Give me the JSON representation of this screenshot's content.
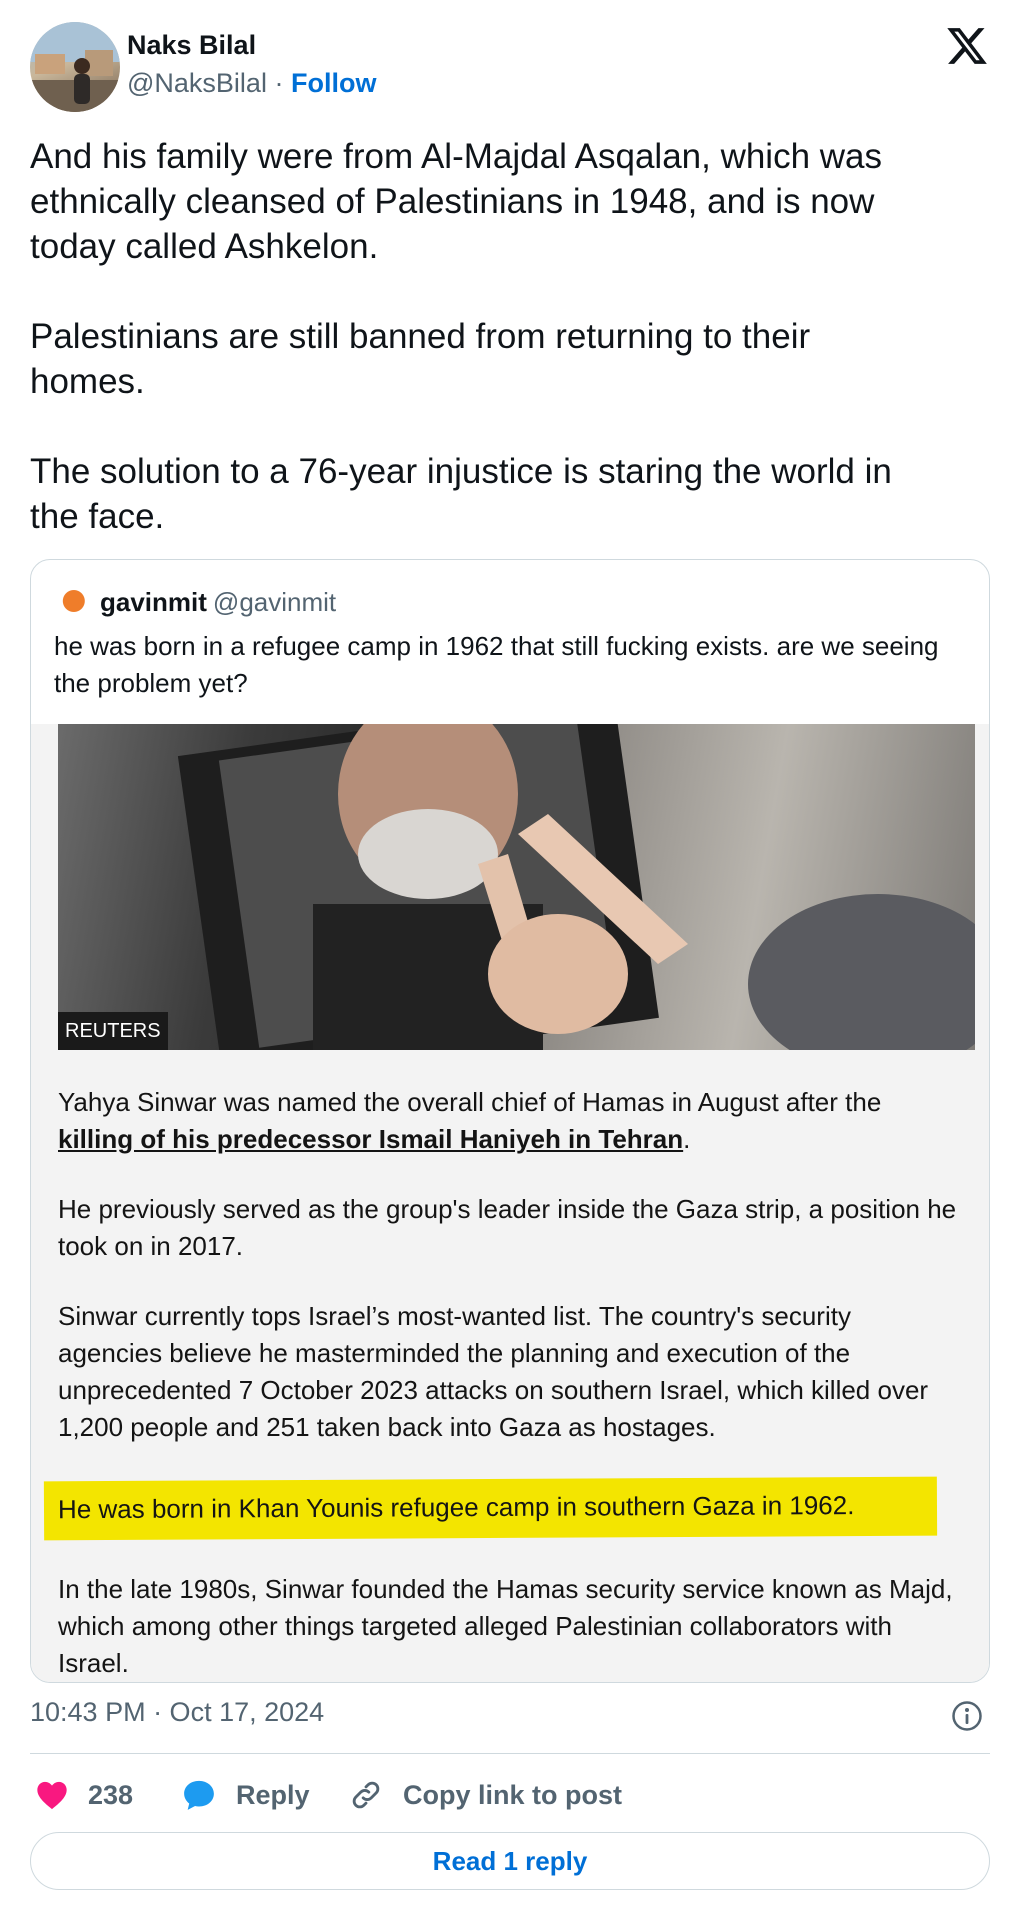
{
  "author": {
    "name": "Naks Bilal",
    "handle": "@NaksBilal",
    "separator": "·",
    "follow_label": "Follow"
  },
  "tweet": {
    "text": "And his family were from Al-Majdal Asqalan, which was\nethnically cleansed of Palestinians in 1948, and is now\ntoday called Ashkelon.\n\nPalestinians are still banned from returning to their\nhomes.\n\nThe solution to a 76-year injustice is staring the world in\nthe face."
  },
  "quote": {
    "name": "gavinmit",
    "handle": "@gavinmit",
    "text": "he was born in a refugee camp in 1962 that still fucking exists. are we seeing the problem yet?",
    "photo_credit": "REUTERS",
    "article": {
      "p1_prefix": "Yahya Sinwar was named the overall chief of Hamas in August after the",
      "p1_link": "killing of his predecessor Ismail Haniyeh in Tehran",
      "p1_suffix": ".",
      "p2": "He previously served as the group's leader inside the Gaza strip, a position he took on in 2017.",
      "p3": "Sinwar currently tops Israel’s most-wanted list. The country's security agencies believe he masterminded the planning and execution of the unprecedented 7 October 2023 attacks on southern Israel, which killed over 1,200 people and 251 taken back into Gaza as hostages.",
      "highlight": "He was born in Khan Younis refugee camp in southern Gaza in 1962.",
      "p5": "In the late 1980s, Sinwar founded the Hamas security service known as Majd, which among other things targeted alleged Palestinian collaborators with Israel."
    }
  },
  "meta": {
    "timestamp": "10:43 PM · Oct 17, 2024"
  },
  "actions": {
    "likes": "238",
    "reply_label": "Reply",
    "copy_label": "Copy link to post"
  },
  "read_replies_label": "Read 1 reply",
  "colors": {
    "link": "#006fd6",
    "like": "#f91880",
    "reply": "#1d9bf0",
    "highlight": "#f3e500",
    "muted": "#536471"
  },
  "icons": [
    "x-logo-icon",
    "info-icon",
    "heart-icon",
    "reply-bubble-icon",
    "link-icon"
  ]
}
